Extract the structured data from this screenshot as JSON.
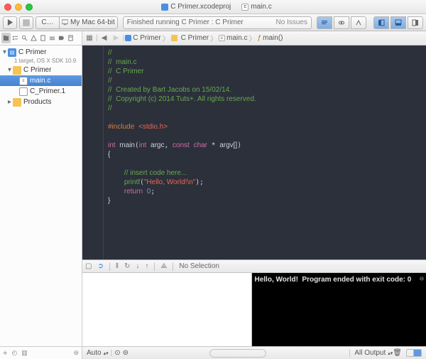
{
  "titlebar": {
    "project_doc": "C Primer.xcodeproj",
    "current_file": "main.c"
  },
  "toolbar": {
    "scheme_target": "C…",
    "scheme_device_prefix": "My Mac 64-bit",
    "activity_text": "Finished running C Primer : C Primer",
    "activity_status": "No Issues"
  },
  "navigator": {
    "project": "C Primer",
    "project_sub": "1 target, OS X SDK 10.9",
    "groups": [
      {
        "name": "C Primer",
        "expanded": true,
        "children": [
          {
            "name": "main.c",
            "selected": true
          },
          {
            "name": "C_Primer.1"
          }
        ]
      },
      {
        "name": "Products",
        "expanded": false
      }
    ]
  },
  "jumpbar": {
    "crumbs": [
      "C Primer",
      "C Primer",
      "main.c",
      "main()"
    ]
  },
  "code": {
    "comment_lines": [
      "//",
      "//  main.c",
      "//  C Primer",
      "//",
      "//  Created by Bart Jacobs on 15/02/14.",
      "//  Copyright (c) 2014 Tuts+. All rights reserved.",
      "//"
    ],
    "include_kw": "#include",
    "include_hdr": "<stdio.h>",
    "ret_type": "int",
    "fn_name": "main",
    "param1_type": "int",
    "param1_name": "argc",
    "param2_qual": "const",
    "param2_type": "char",
    "param2_name": "argv[]",
    "body_open": "{",
    "body_close": "}",
    "insert_comment": "// insert code here...",
    "printf_fn": "printf",
    "printf_arg": "\"Hello, World!\\n\"",
    "return_kw": "return",
    "return_val": "0"
  },
  "debug": {
    "no_selection": "No Selection",
    "console_line1": "Hello, World!",
    "console_line2": "Program ended with exit code: 0",
    "auto_label": "Auto",
    "all_output_label": "All Output"
  }
}
